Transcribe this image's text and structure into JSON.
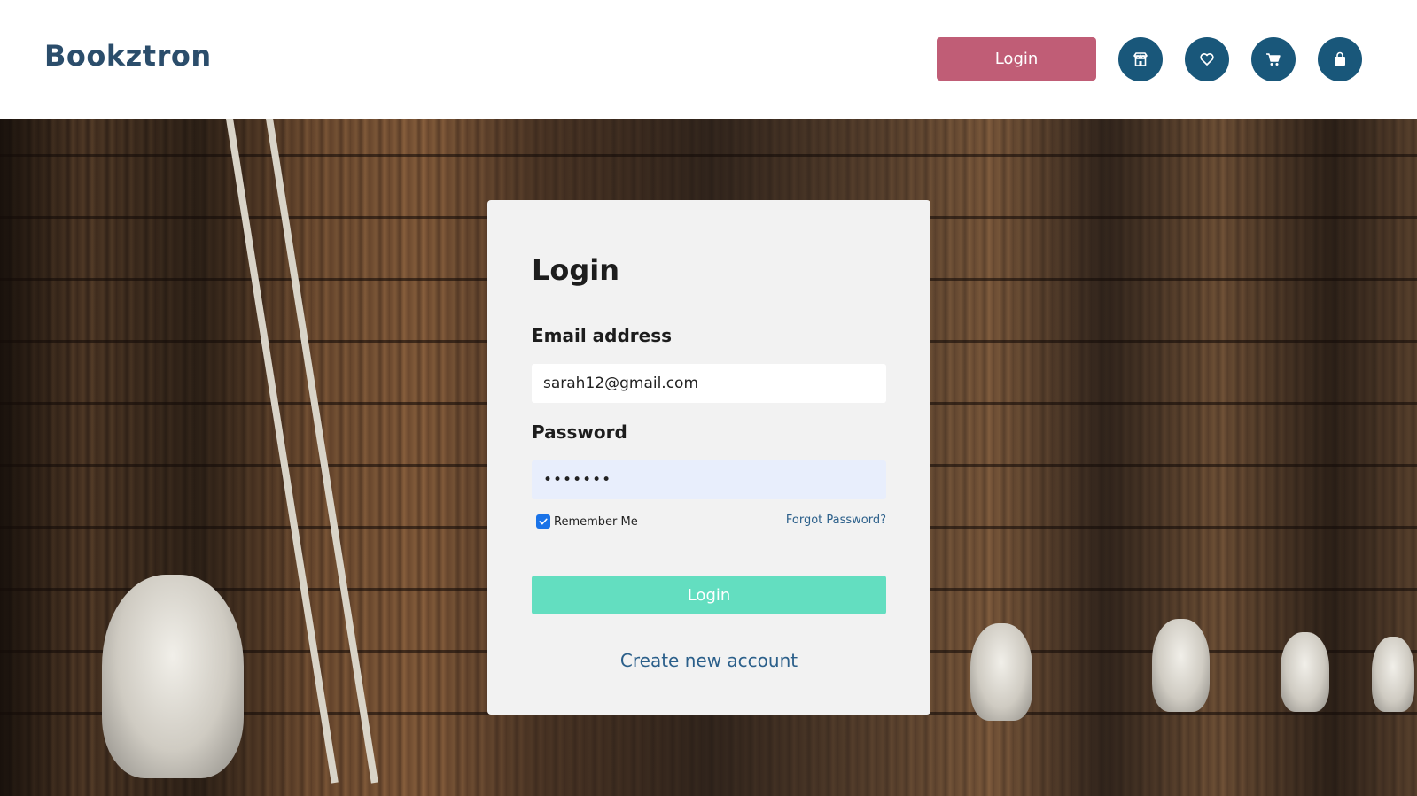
{
  "header": {
    "brand": "Bookztron",
    "login_button": "Login",
    "icons": [
      "store-icon",
      "heart-icon",
      "cart-icon",
      "bag-icon"
    ]
  },
  "login_form": {
    "title": "Login",
    "email_label": "Email address",
    "email_value": "sarah12@gmail.com",
    "password_label": "Password",
    "password_value": "•••••••",
    "remember_label": "Remember Me",
    "remember_checked": true,
    "forgot_link": "Forgot Password?",
    "submit_label": "Login",
    "create_account_link": "Create new account"
  },
  "colors": {
    "brand": "#2b4d6b",
    "login_top_bg": "#c05d76",
    "icon_bg": "#19577a",
    "submit_bg": "#63dec0",
    "link": "#2b5f8a"
  }
}
